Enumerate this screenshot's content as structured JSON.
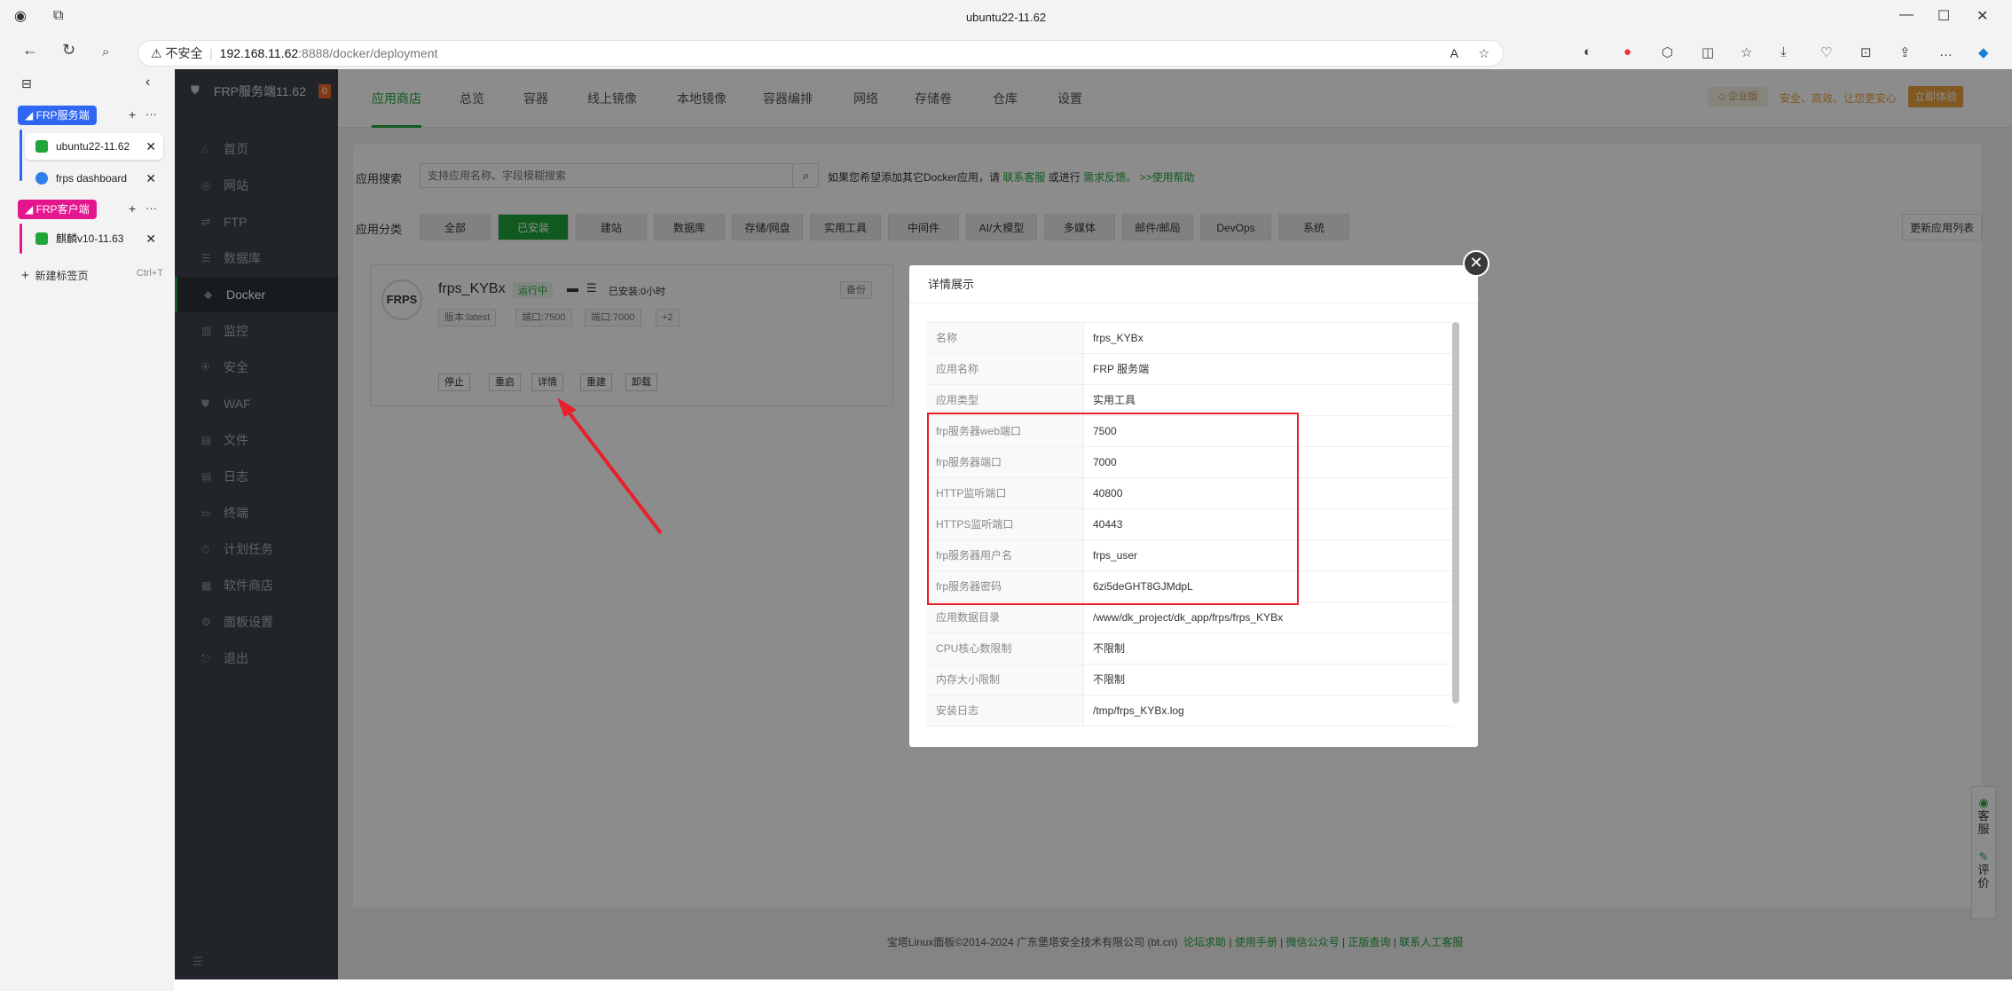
{
  "window": {
    "title": "ubuntu22-11.62"
  },
  "address": {
    "security_label": "不安全",
    "host": "192.168.11.62",
    "path": ":8888/docker/deployment"
  },
  "tabs": {
    "groups": [
      {
        "label": "FRP服务端",
        "color": "#2f66f4"
      },
      {
        "label": "FRP客户端",
        "color": "#e3168e"
      }
    ],
    "items": [
      "ubuntu22-11.62",
      "frps dashboard",
      "麒麟v10-11.63"
    ],
    "new_tab": "新建标签页",
    "new_tab_shortcut": "Ctrl+T"
  },
  "sidebar": {
    "title": "FRP服务端11.62",
    "badge": "0",
    "items": [
      "首页",
      "网站",
      "FTP",
      "数据库",
      "Docker",
      "监控",
      "安全",
      "WAF",
      "文件",
      "日志",
      "终端",
      "计划任务",
      "软件商店",
      "面板设置",
      "退出"
    ]
  },
  "topnav": {
    "items": [
      "应用商店",
      "总览",
      "容器",
      "线上镜像",
      "本地镜像",
      "容器编排",
      "网络",
      "存储卷",
      "仓库",
      "设置"
    ],
    "promo_text": "安全、高效、让您更安心",
    "promo_button": "立即体验"
  },
  "search": {
    "label": "应用搜索",
    "placeholder": "支持应用名称、字段模糊搜索",
    "hint": "如果您希望添加其它Docker应用，请",
    "link1": "联系客服",
    "hint2": "或进行",
    "link2": "需求反馈。",
    "help": ">>使用帮助"
  },
  "categories": {
    "label": "应用分类",
    "items": [
      "全部",
      "已安装",
      "建站",
      "数据库",
      "存储/网盘",
      "实用工具",
      "中间件",
      "AI/大模型",
      "多媒体",
      "邮件/邮局",
      "DevOps",
      "系统"
    ],
    "refresh": "更新应用列表"
  },
  "app_card": {
    "logo": "FRPS",
    "name": "frps_KYBx",
    "status": "运行中",
    "installed": "已安装:0小时",
    "backup": "备份",
    "chips": [
      "版本:latest",
      "端口:7500",
      "端口:7000",
      "+2"
    ],
    "ops": [
      "停止",
      "重启",
      "详情",
      "重建",
      "卸载"
    ]
  },
  "modal": {
    "title": "详情展示",
    "rows": [
      {
        "k": "名称",
        "v": "frps_KYBx"
      },
      {
        "k": "应用名称",
        "v": "FRP 服务端"
      },
      {
        "k": "应用类型",
        "v": "实用工具"
      },
      {
        "k": "frp服务器web端口",
        "v": "7500"
      },
      {
        "k": "frp服务器端口",
        "v": "7000"
      },
      {
        "k": "HTTP监听端口",
        "v": "40800"
      },
      {
        "k": "HTTPS监听端口",
        "v": "40443"
      },
      {
        "k": "frp服务器用户名",
        "v": "frps_user"
      },
      {
        "k": "frp服务器密码",
        "v": "6zi5deGHT8GJMdpL"
      },
      {
        "k": "应用数据目录",
        "v": "/www/dk_project/dk_app/frps/frps_KYBx"
      },
      {
        "k": "CPU核心数限制",
        "v": "不限制"
      },
      {
        "k": "内存大小限制",
        "v": "不限制"
      },
      {
        "k": "安装日志",
        "v": "/tmp/frps_KYBx.log"
      }
    ]
  },
  "footer": {
    "text": "宝塔Linux面板©2014-2024 广东堡塔安全技术有限公司 (bt.cn)",
    "links": [
      "论坛求助",
      "使用手册",
      "微信公众号",
      "正版查询",
      "联系人工客服"
    ]
  },
  "float": {
    "service": "客服",
    "review": "评价"
  },
  "colors": {
    "accent": "#20a53a",
    "red_box": "#e8202b",
    "group_blue": "#2f66f4",
    "group_pink": "#e3168e"
  }
}
